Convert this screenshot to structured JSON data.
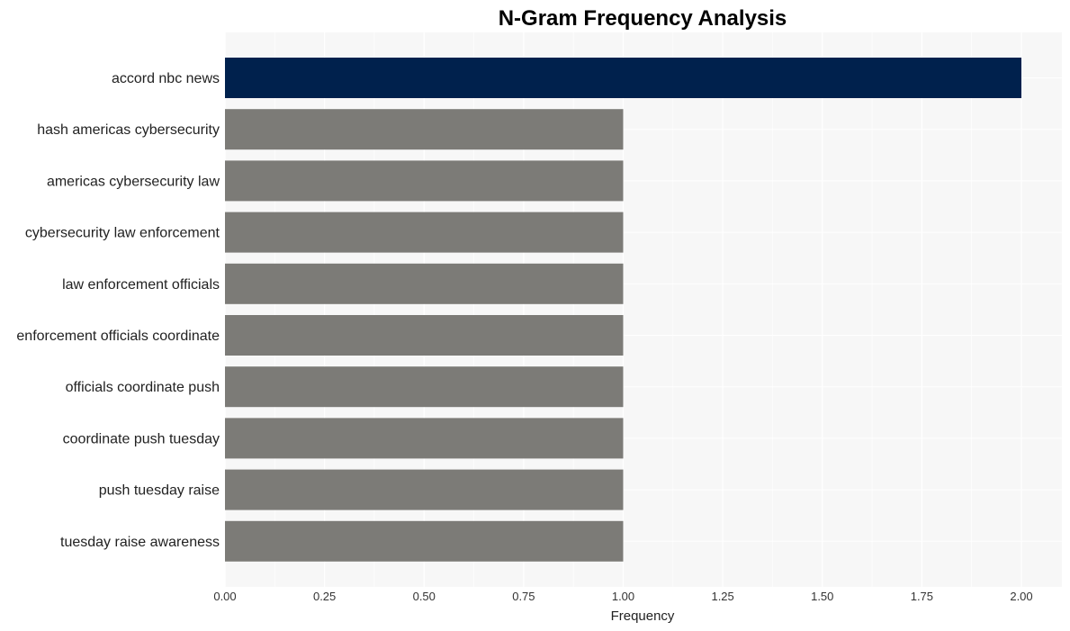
{
  "chart_data": {
    "type": "bar",
    "orientation": "horizontal",
    "title": "N-Gram Frequency Analysis",
    "xlabel": "Frequency",
    "ylabel": "",
    "xlim": [
      0,
      2.1
    ],
    "xticks": [
      0,
      0.25,
      0.5,
      0.75,
      1.0,
      1.25,
      1.5,
      1.75,
      2.0
    ],
    "xtick_labels": [
      "0.00",
      "0.25",
      "0.50",
      "0.75",
      "1.00",
      "1.25",
      "1.50",
      "1.75",
      "2.00"
    ],
    "grid": true,
    "categories": [
      "accord nbc news",
      "hash americas cybersecurity",
      "americas cybersecurity law",
      "cybersecurity law enforcement",
      "law enforcement officials",
      "enforcement officials coordinate",
      "officials coordinate push",
      "coordinate push tuesday",
      "push tuesday raise",
      "tuesday raise awareness"
    ],
    "values": [
      2,
      1,
      1,
      1,
      1,
      1,
      1,
      1,
      1,
      1
    ],
    "colors": {
      "highlight": "#00214d",
      "default": "#7c7b77",
      "panel_bg": "#f7f7f7",
      "grid": "#ffffff"
    }
  }
}
